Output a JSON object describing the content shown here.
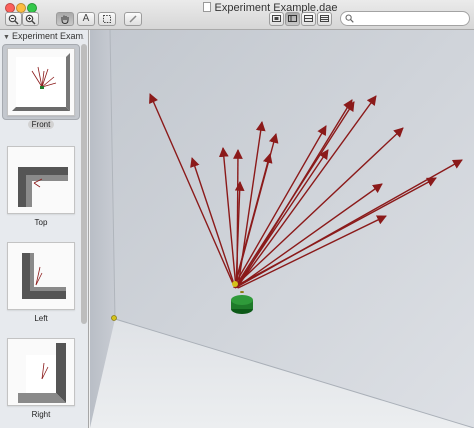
{
  "window": {
    "title": "Experiment Example.dae"
  },
  "toolbar": {
    "zoom_out": "zoom-out-icon",
    "zoom_in": "zoom-in-icon",
    "hand": "hand-icon",
    "text_tool": "A",
    "selection": "selection-icon",
    "edit": "edit-icon",
    "view_modes": [
      "view-mode-1",
      "view-mode-2",
      "view-mode-3",
      "view-mode-4"
    ]
  },
  "search": {
    "placeholder": "",
    "value": ""
  },
  "sidebar": {
    "header": "Experiment Exam...",
    "items": [
      {
        "label": "Front",
        "selected": true
      },
      {
        "label": "Top",
        "selected": false
      },
      {
        "label": "Left",
        "selected": false
      },
      {
        "label": "Right",
        "selected": false
      }
    ]
  },
  "colors": {
    "arrows": "#8b1a1a",
    "base": "#1f7a2a",
    "wall": "#d9dde3",
    "floor": "#e5e7ea",
    "selection": "#c4c8ce"
  }
}
